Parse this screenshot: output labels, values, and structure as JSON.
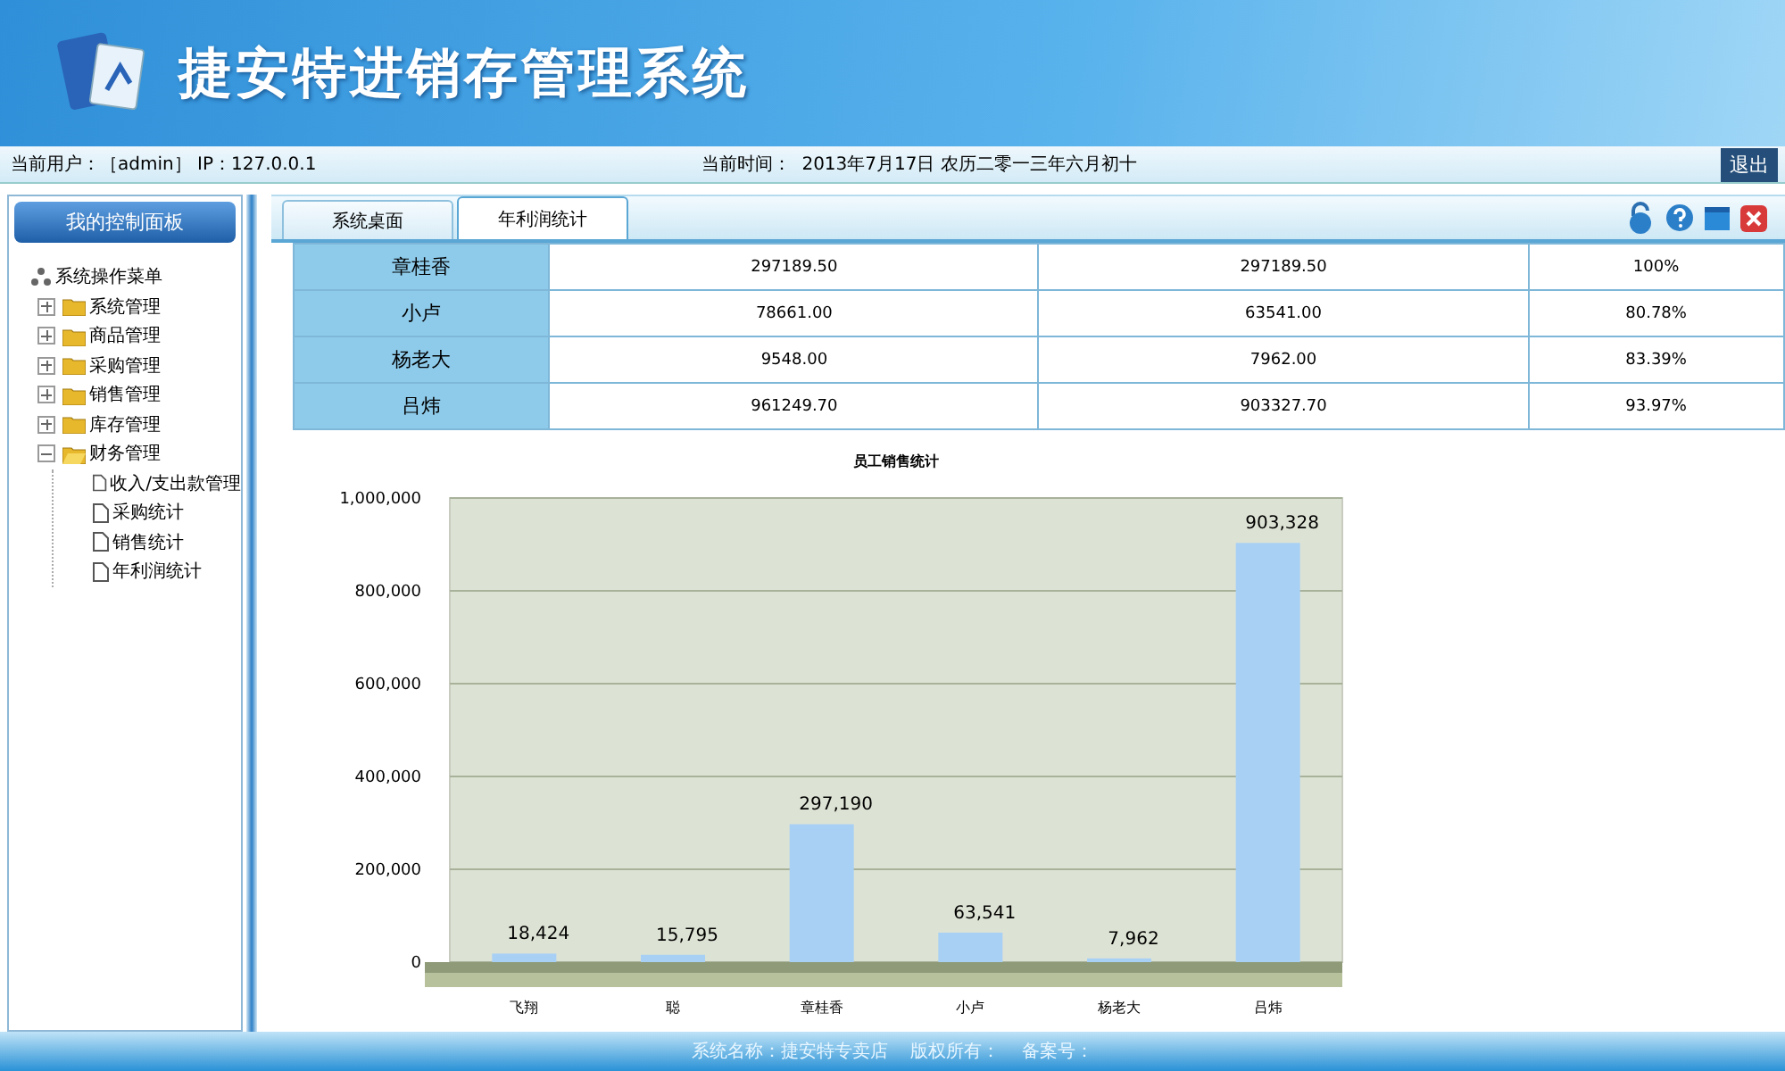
{
  "header": {
    "title": "捷安特进销存管理系统"
  },
  "info_bar": {
    "user": "当前用户：［admin］ IP：127.0.0.1",
    "time_label": "当前时间：",
    "time": "2013年7月17日 农历二零一三年六月初十",
    "logout": "退出"
  },
  "sidebar": {
    "title": "我的控制面板",
    "tree": [
      {
        "label": "系统操作菜单",
        "kind": "root",
        "children": [
          {
            "label": "系统管理",
            "kind": "folder",
            "expanded": false
          },
          {
            "label": "商品管理",
            "kind": "folder",
            "expanded": false
          },
          {
            "label": "采购管理",
            "kind": "folder",
            "expanded": false
          },
          {
            "label": "销售管理",
            "kind": "folder",
            "expanded": false
          },
          {
            "label": "库存管理",
            "kind": "folder",
            "expanded": false
          },
          {
            "label": "财务管理",
            "kind": "folder",
            "expanded": true,
            "children": [
              {
                "label": "收入/支出款管理",
                "kind": "page"
              },
              {
                "label": "采购统计",
                "kind": "page"
              },
              {
                "label": "销售统计",
                "kind": "page"
              },
              {
                "label": "年利润统计",
                "kind": "page"
              }
            ]
          }
        ]
      }
    ]
  },
  "tabs": [
    {
      "label": "系统桌面",
      "selected": false
    },
    {
      "label": "年利润统计",
      "selected": true
    }
  ],
  "table": {
    "rows": [
      [
        "章桂香",
        "297189.50",
        "297189.50",
        "100%"
      ],
      [
        "小卢",
        "78661.00",
        "63541.00",
        "80.78%"
      ],
      [
        "杨老大",
        "9548.00",
        "7962.00",
        "83.39%"
      ],
      [
        "吕炜",
        "961249.70",
        "903327.70",
        "93.97%"
      ]
    ]
  },
  "chart_data": {
    "type": "bar",
    "title": "员工销售统计",
    "categories": [
      "飞翔",
      "聪",
      "章桂香",
      "小卢",
      "杨老大",
      "吕炜"
    ],
    "grid": true,
    "series": [
      {
        "color": "#a8d0f5",
        "values": [
          18424,
          15795,
          297190,
          63541,
          7962,
          903328
        ]
      }
    ],
    "ylim": [
      0,
      1000000
    ],
    "yticks": [
      {
        "value": 0,
        "label": "0"
      },
      {
        "value": 200000,
        "label": "200,000"
      },
      {
        "value": 400000,
        "label": "400,000"
      },
      {
        "value": 600000,
        "label": "600,000"
      },
      {
        "value": 800000,
        "label": "800,000"
      },
      {
        "value": 1000000,
        "label": "1,000,000"
      }
    ],
    "value_labels": [
      "18,424",
      "15,795",
      "297,190",
      "63,541",
      "7,962",
      "903,328"
    ]
  },
  "footer": {
    "text": "系统名称：捷安特专卖店    版权所有：    备案号："
  }
}
